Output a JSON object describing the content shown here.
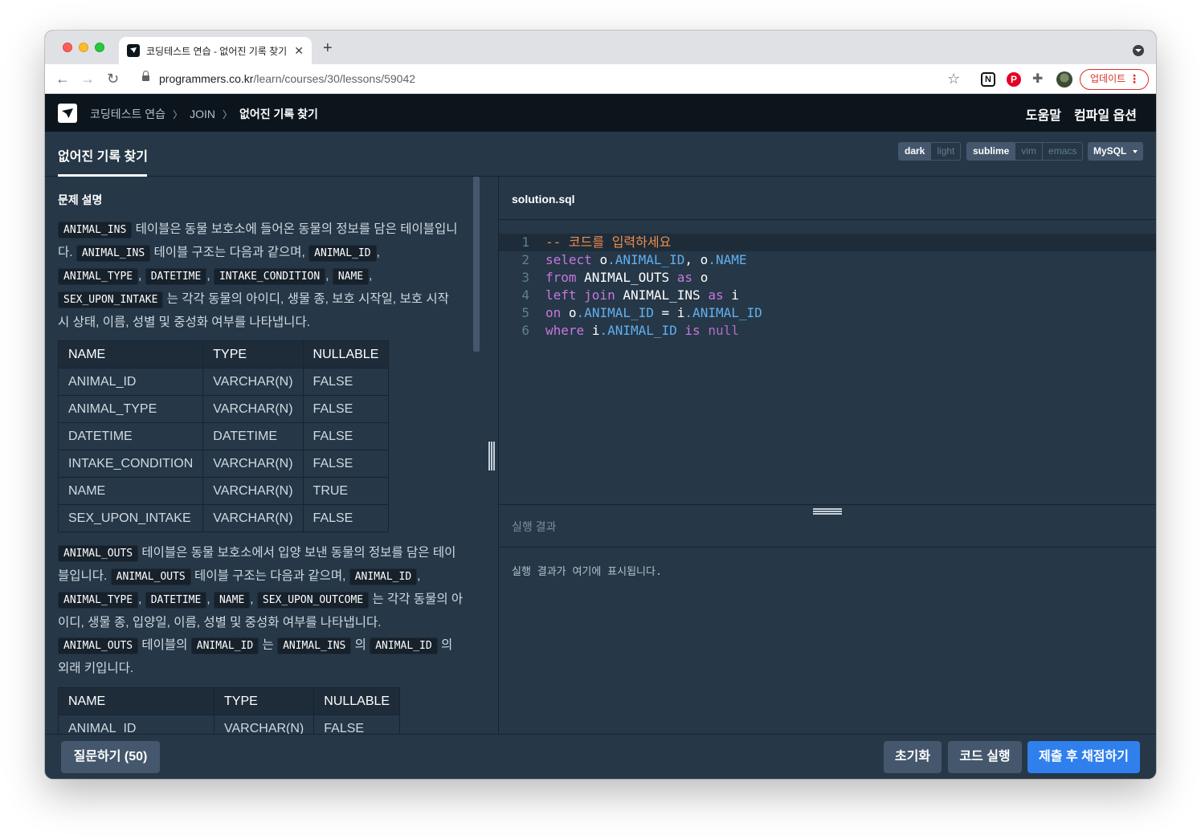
{
  "browser": {
    "tab_title": "코딩테스트 연습 - 없어진 기록 찾기 |",
    "url_host": "programmers.co.kr",
    "url_path": "/learn/courses/30/lessons/59042",
    "update_label": "업데이트"
  },
  "header": {
    "breadcrumbs": [
      "코딩테스트 연습",
      "JOIN",
      "없어진 기록 찾기"
    ],
    "help_label": "도움말",
    "compile_options_label": "컴파일 옵션"
  },
  "titlebar": {
    "title": "없어진 기록 찾기",
    "themes": [
      "dark",
      "light"
    ],
    "keymaps": [
      "sublime",
      "vim",
      "emacs"
    ],
    "language": "MySQL"
  },
  "description": {
    "heading": "문제 설명",
    "p1": {
      "code_animal_ins": "ANIMAL_INS",
      "text_a": " 테이블은 동물 보호소에 들어온 동물의 정보를 담은 테이블입니다. ",
      "text_b": " 테이블 구조는 다음과 같으며, ",
      "code_animal_id": "ANIMAL_ID",
      "comma": ", ",
      "code_animal_type": "ANIMAL_TYPE",
      "code_datetime": "DATETIME",
      "code_intake_condition": "INTAKE_CONDITION",
      "code_name": "NAME",
      "code_sex_upon_intake": "SEX_UPON_INTAKE",
      "text_c": " 는 각각 동물의 아이디, 생물 종, 보호 시작일, 보호 시작 시 상태, 이름, 성별 및 중성화 여부를 나타냅니다."
    },
    "table1": {
      "headers": [
        "NAME",
        "TYPE",
        "NULLABLE"
      ],
      "rows": [
        [
          "ANIMAL_ID",
          "VARCHAR(N)",
          "FALSE"
        ],
        [
          "ANIMAL_TYPE",
          "VARCHAR(N)",
          "FALSE"
        ],
        [
          "DATETIME",
          "DATETIME",
          "FALSE"
        ],
        [
          "INTAKE_CONDITION",
          "VARCHAR(N)",
          "FALSE"
        ],
        [
          "NAME",
          "VARCHAR(N)",
          "TRUE"
        ],
        [
          "SEX_UPON_INTAKE",
          "VARCHAR(N)",
          "FALSE"
        ]
      ]
    },
    "p2": {
      "code_animal_outs": "ANIMAL_OUTS",
      "text_a": " 테이블은 동물 보호소에서 입양 보낸 동물의 정보를 담은 테이블입니다. ",
      "text_b": " 테이블 구조는 다음과 같으며, ",
      "code_animal_id": "ANIMAL_ID",
      "comma": ", ",
      "code_animal_type": "ANIMAL_TYPE",
      "code_datetime": "DATETIME",
      "code_name": "NAME",
      "code_sex_upon_outcome": "SEX_UPON_OUTCOME",
      "text_c": " 는 각각 동물의 아이디, 생물 종, 입양일, 이름, 성별 및 중성화 여부를 나타냅니다. ",
      "text_d": " 테이블의 ",
      "text_e": " 는 ",
      "code_animal_ins": "ANIMAL_INS",
      "text_f": " 의 ",
      "text_g": " 의 외래 키입니다."
    },
    "table2": {
      "headers": [
        "NAME",
        "TYPE",
        "NULLABLE"
      ],
      "rows": [
        [
          "ANIMAL_ID",
          "VARCHAR(N)",
          "FALSE"
        ]
      ]
    }
  },
  "editor": {
    "file_name": "solution.sql",
    "line_numbers": [
      "1",
      "2",
      "3",
      "4",
      "5",
      "6"
    ],
    "tokens": {
      "comment": "-- 코드를 입력하세요",
      "select": "select",
      "from": "from",
      "left_join": "left join",
      "as": "as",
      "on": "on",
      "where": "where",
      "is": "is",
      "null": "null",
      "alias_o": "o",
      "alias_i": "i",
      "dot_animal_id": ".ANIMAL_ID",
      "dot_name": ".NAME",
      "comma_sp": ", ",
      "eq": " = ",
      "animal_outs": "ANIMAL_OUTS",
      "animal_ins": "ANIMAL_INS"
    }
  },
  "result": {
    "label": "실행 결과",
    "placeholder": "실행 결과가 여기에 표시됩니다."
  },
  "footer": {
    "ask_label": "질문하기 (50)",
    "reset_label": "초기화",
    "run_label": "코드 실행",
    "submit_label": "제출 후 채점하기"
  },
  "colors": {
    "background": "#263747",
    "header": "#0c151c",
    "primary": "#2f80ed",
    "secondary_button": "#44576c"
  }
}
